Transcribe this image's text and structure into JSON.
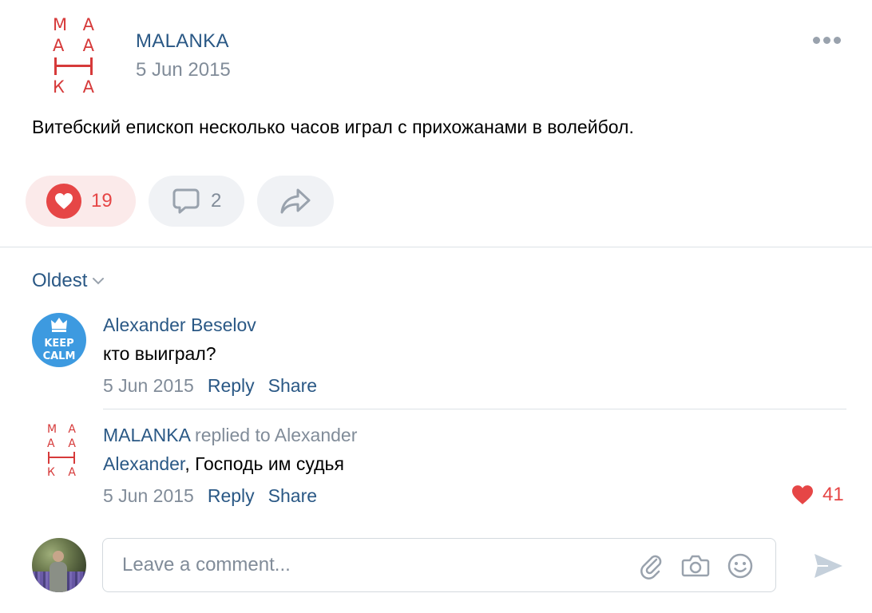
{
  "post": {
    "author": "MALANKA",
    "date": "5 Jun 2015",
    "text": "Витебский епископ несколько часов играл с прихожанами в волейбол.",
    "likes": "19",
    "comments": "2"
  },
  "logo": {
    "letters": [
      "М",
      "А",
      "А",
      "А",
      "К",
      "А"
    ]
  },
  "sort": {
    "label": "Oldest"
  },
  "comments": [
    {
      "author": "Alexander Beselov",
      "avatar_text": [
        "KEEP",
        "CALM"
      ],
      "text": "кто выиграл?",
      "date": "5 Jun 2015",
      "reply_label": "Reply",
      "share_label": "Share"
    },
    {
      "author": "MALANKA",
      "replied_to": "replied to Alexander",
      "mention": "Alexander",
      "text": ", Господь им судья",
      "date": "5 Jun 2015",
      "reply_label": "Reply",
      "share_label": "Share",
      "likes": "41"
    }
  ],
  "composer": {
    "placeholder": "Leave a comment..."
  },
  "colors": {
    "link": "#2a5885",
    "like": "#e64646",
    "muted": "#818c99",
    "logo": "#d63a3a"
  }
}
